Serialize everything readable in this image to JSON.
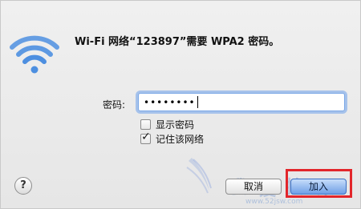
{
  "dialog": {
    "title": "Wi-Fi 网络“123897”需要 WPA2 密码。",
    "icon": "wifi-icon"
  },
  "password": {
    "label": "密码:",
    "masked_value": "••••••••"
  },
  "options": {
    "show_password": {
      "label": "显示密码",
      "checked": false
    },
    "remember_network": {
      "label": "记住该网络",
      "checked": true
    }
  },
  "buttons": {
    "help": "?",
    "cancel": "取消",
    "join": "加入"
  },
  "watermark": {
    "w1": "我",
    "w2": "爱",
    "w3": "技",
    "w4": "术",
    "url": "www.52jsw.com"
  },
  "colors": {
    "wifi_blue": "#4d8fe0",
    "focus_ring": "#6ea0eb",
    "highlight_red": "#e2262b"
  }
}
